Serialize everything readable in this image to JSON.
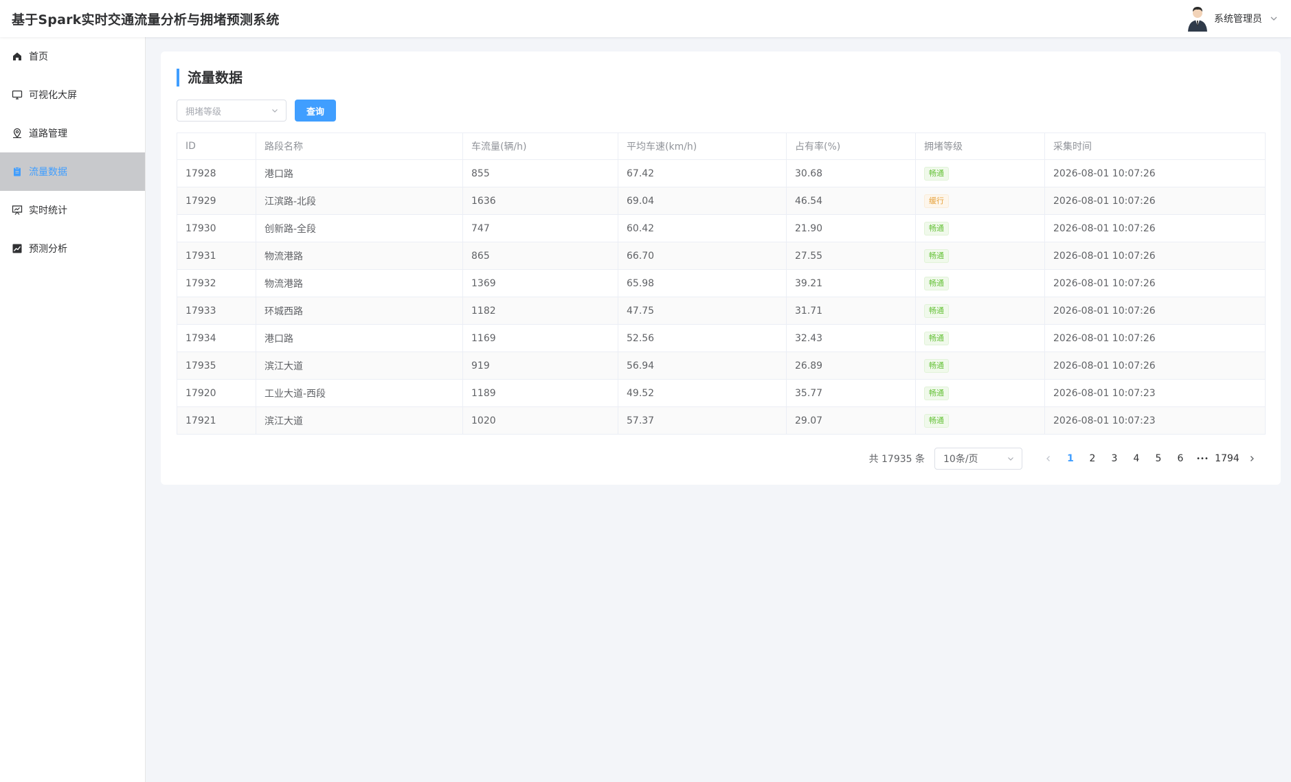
{
  "header": {
    "app_title": "基于Spark实时交通流量分析与拥堵预测系统",
    "user_name": "系统管理员"
  },
  "sidebar": {
    "items": [
      {
        "label": "首页",
        "icon": "home-icon"
      },
      {
        "label": "可视化大屏",
        "icon": "monitor-icon"
      },
      {
        "label": "道路管理",
        "icon": "map-pin-icon"
      },
      {
        "label": "流量数据",
        "icon": "document-icon",
        "active": true
      },
      {
        "label": "实时统计",
        "icon": "presentation-chart-icon"
      },
      {
        "label": "预测分析",
        "icon": "trend-chart-icon"
      }
    ]
  },
  "main": {
    "title": "流量数据",
    "filter": {
      "placeholder": "拥堵等级"
    },
    "query_label": "查询",
    "table": {
      "headers": [
        "ID",
        "路段名称",
        "车流量(辆/h)",
        "平均车速(km/h)",
        "占有率(%)",
        "拥堵等级",
        "采集时间"
      ],
      "rows": [
        {
          "id": "17928",
          "road": "港口路",
          "flow": "855",
          "speed": "67.42",
          "occupancy": "30.68",
          "level": "畅通",
          "time": "2026-08-01 10:07:26"
        },
        {
          "id": "17929",
          "road": "江滨路-北段",
          "flow": "1636",
          "speed": "69.04",
          "occupancy": "46.54",
          "level": "缓行",
          "time": "2026-08-01 10:07:26"
        },
        {
          "id": "17930",
          "road": "创新路-全段",
          "flow": "747",
          "speed": "60.42",
          "occupancy": "21.90",
          "level": "畅通",
          "time": "2026-08-01 10:07:26"
        },
        {
          "id": "17931",
          "road": "物流港路",
          "flow": "865",
          "speed": "66.70",
          "occupancy": "27.55",
          "level": "畅通",
          "time": "2026-08-01 10:07:26"
        },
        {
          "id": "17932",
          "road": "物流港路",
          "flow": "1369",
          "speed": "65.98",
          "occupancy": "39.21",
          "level": "畅通",
          "time": "2026-08-01 10:07:26"
        },
        {
          "id": "17933",
          "road": "环城西路",
          "flow": "1182",
          "speed": "47.75",
          "occupancy": "31.71",
          "level": "畅通",
          "time": "2026-08-01 10:07:26"
        },
        {
          "id": "17934",
          "road": "港口路",
          "flow": "1169",
          "speed": "52.56",
          "occupancy": "32.43",
          "level": "畅通",
          "time": "2026-08-01 10:07:26"
        },
        {
          "id": "17935",
          "road": "滨江大道",
          "flow": "919",
          "speed": "56.94",
          "occupancy": "26.89",
          "level": "畅通",
          "time": "2026-08-01 10:07:26"
        },
        {
          "id": "17920",
          "road": "工业大道-西段",
          "flow": "1189",
          "speed": "49.52",
          "occupancy": "35.77",
          "level": "畅通",
          "time": "2026-08-01 10:07:23"
        },
        {
          "id": "17921",
          "road": "滨江大道",
          "flow": "1020",
          "speed": "57.37",
          "occupancy": "29.07",
          "level": "畅通",
          "time": "2026-08-01 10:07:23"
        }
      ]
    },
    "pagination": {
      "total_text": "共 17935 条",
      "page_size": "10条/页",
      "pages": [
        "1",
        "2",
        "3",
        "4",
        "5",
        "6"
      ],
      "current": "1",
      "ellipsis": "•••",
      "last_page": "1794"
    }
  },
  "colors": {
    "accent": "#409eff",
    "success": "#67c23a",
    "warning": "#e6a23c",
    "active_menu_bg": "#c8c9cc"
  }
}
